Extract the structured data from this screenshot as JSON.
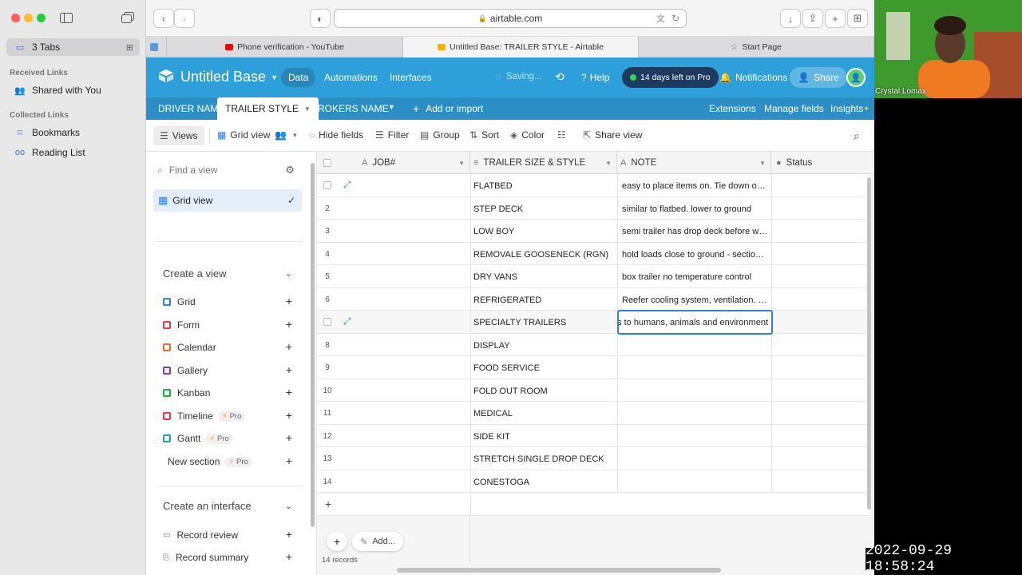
{
  "sidebar": {
    "tabs_label": "3 Tabs",
    "received_heading": "Received Links",
    "shared_label": "Shared with You",
    "collected_heading": "Collected Links",
    "bookmarks_label": "Bookmarks",
    "reading_list_label": "Reading List"
  },
  "browser": {
    "url": "airtable.com",
    "tabs": [
      {
        "label": "Phone verification - YouTube",
        "favicon_color": "#ff0000"
      },
      {
        "label": "Untitled Base: TRAILER STYLE - Airtable",
        "favicon_color": "#fcb400"
      },
      {
        "label": "Start Page",
        "favicon_color": "#777777"
      }
    ]
  },
  "base": {
    "title": "Untitled Base",
    "nav": [
      "Data",
      "Automations",
      "Interfaces"
    ],
    "saving": "Saving...",
    "help": "Help",
    "trial": "14 days left on Pro",
    "notifications": "Notifications",
    "share": "Share",
    "tables": [
      "DRIVER NAME",
      "TRAILER STYLE",
      "BROKERS NAME"
    ],
    "add_import": "Add or import",
    "extensions": "Extensions",
    "manage_fields": "Manage fields",
    "insights": "Insights",
    "colors": {
      "header": "#2d9fd9",
      "subheader": "#2b8fc6",
      "trial_pill": "#1f3a5f"
    }
  },
  "viewbar": {
    "views": "Views",
    "grid_view": "Grid view",
    "hide_fields": "Hide fields",
    "filter": "Filter",
    "group": "Group",
    "sort": "Sort",
    "color": "Color",
    "share_view": "Share view"
  },
  "views_panel": {
    "find_placeholder": "Find a view",
    "current_view": "Grid view",
    "create_view_heading": "Create a view",
    "create_items": [
      {
        "label": "Grid",
        "color": "#2d7ff9",
        "pro": ""
      },
      {
        "label": "Form",
        "color": "#e8384f",
        "pro": ""
      },
      {
        "label": "Calendar",
        "color": "#e86e2c",
        "pro": ""
      },
      {
        "label": "Gallery",
        "color": "#7c3ad8",
        "pro": ""
      },
      {
        "label": "Kanban",
        "color": "#20b037",
        "pro": ""
      },
      {
        "label": "Timeline",
        "color": "#e8384f",
        "pro": "Pro"
      },
      {
        "label": "Gantt",
        "color": "#20a5a5",
        "pro": "Pro"
      },
      {
        "label": "New section",
        "color": "",
        "pro": "Pro"
      }
    ],
    "create_interface_heading": "Create an interface",
    "interface_items": [
      "Record review",
      "Record summary"
    ]
  },
  "grid": {
    "columns": [
      "JOB#",
      "TRAILER SIZE & STYLE",
      "NOTE",
      "Status"
    ],
    "rows": [
      {
        "num": "1",
        "size": "FLATBED",
        "note": "easy to place items on. Tie down odd shaped loads"
      },
      {
        "num": "2",
        "size": "STEP DECK",
        "note": "similar to flatbed. lower to ground"
      },
      {
        "num": "3",
        "size": "LOW BOY",
        "note": "semi trailer has drop deck before wheels"
      },
      {
        "num": "4",
        "size": "REMOVALE GOOSENECK (RGN)",
        "note": "hold loads close to ground - section in front"
      },
      {
        "num": "5",
        "size": "DRY VANS",
        "note": "box trailer no temperature control"
      },
      {
        "num": "6",
        "size": "REFRIGERATED",
        "note": "Reefer cooling system, ventilation. transport"
      },
      {
        "num": "7",
        "size": "SPECIALTY TRAILERS",
        "note": ""
      },
      {
        "num": "8",
        "size": "DISPLAY",
        "note": ""
      },
      {
        "num": "9",
        "size": "FOOD SERVICE",
        "note": ""
      },
      {
        "num": "10",
        "size": "FOLD OUT ROOM",
        "note": ""
      },
      {
        "num": "11",
        "size": "MEDICAL",
        "note": ""
      },
      {
        "num": "12",
        "size": "SIDE KIT",
        "note": ""
      },
      {
        "num": "13",
        "size": "STRETCH SINGLE DROP DECK",
        "note": ""
      },
      {
        "num": "14",
        "size": "CONESTOGA",
        "note": ""
      }
    ],
    "editing_value": "s to humans, animals and environment",
    "add_label": "Add...",
    "record_count": "14 records"
  },
  "overlay": {
    "cam_name": "Crystal Lomax",
    "timestamp": "2022-09-29 18:58:24"
  }
}
